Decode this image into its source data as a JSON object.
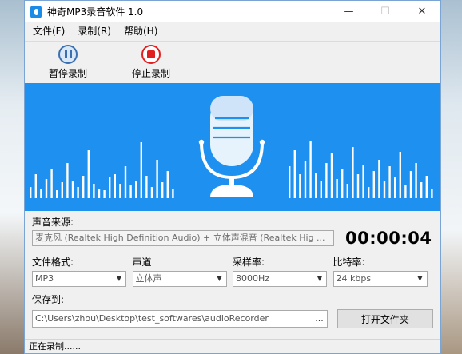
{
  "window": {
    "title": "神奇MP3录音软件 1.0",
    "minimize_glyph": "—",
    "maximize_glyph": "☐",
    "close_glyph": "✕"
  },
  "menu": [
    {
      "label": "文件(F)"
    },
    {
      "label": "录制(R)"
    },
    {
      "label": "帮助(H)"
    }
  ],
  "toolbar": {
    "pause_label": "暂停录制",
    "stop_label": "停止录制"
  },
  "banner": {
    "background_color": "#1e90f0",
    "icon": "microphone-icon"
  },
  "source": {
    "label": "声音来源:",
    "value": "麦克风 (Realtek High Definition Audio) + 立体声混音 (Realtek Hig ..."
  },
  "timer": "00:00:04",
  "settings": {
    "format": {
      "label": "文件格式:",
      "value": "MP3"
    },
    "channel": {
      "label": "声道",
      "value": "立体声"
    },
    "sample_rate": {
      "label": "采样率:",
      "value": "8000Hz"
    },
    "bitrate": {
      "label": "比特率:",
      "value": "24 kbps"
    }
  },
  "save": {
    "label": "保存到:",
    "path": "C:\\Users\\zhou\\Desktop\\test_softwares\\audioRecorder",
    "browse": "...",
    "open_folder_label": "打开文件夹"
  },
  "status": "正在录制......"
}
